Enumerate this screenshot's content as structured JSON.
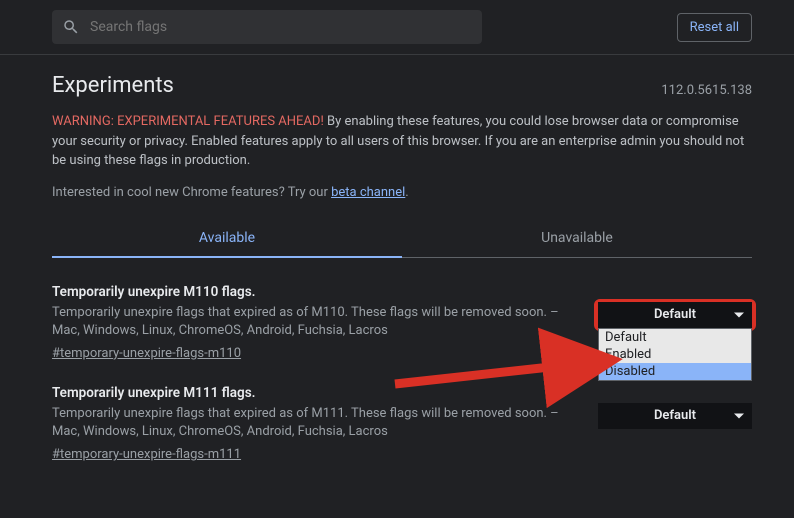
{
  "search": {
    "placeholder": "Search flags"
  },
  "reset_label": "Reset all",
  "title": "Experiments",
  "version": "112.0.5615.138",
  "warning_prefix": "WARNING: EXPERIMENTAL FEATURES AHEAD!",
  "warning_body": " By enabling these features, you could lose browser data or compromise your security or privacy. Enabled features apply to all users of this browser. If you are an enterprise admin you should not be using these flags in production.",
  "interest_text": "Interested in cool new Chrome features? Try our ",
  "beta_link": "beta channel",
  "tabs": {
    "available": "Available",
    "unavailable": "Unavailable"
  },
  "flags": [
    {
      "title": "Temporarily unexpire M110 flags.",
      "desc": "Temporarily unexpire flags that expired as of M110. These flags will be removed soon. – Mac, Windows, Linux, ChromeOS, Android, Fuchsia, Lacros",
      "anchor": "#temporary-unexpire-flags-m110",
      "value": "Default"
    },
    {
      "title": "Temporarily unexpire M111 flags.",
      "desc": "Temporarily unexpire flags that expired as of M111. These flags will be removed soon. – Mac, Windows, Linux, ChromeOS, Android, Fuchsia, Lacros",
      "anchor": "#temporary-unexpire-flags-m111",
      "value": "Default"
    }
  ],
  "dropdown_options": {
    "o0": "Default",
    "o1": "Enabled",
    "o2": "Disabled"
  },
  "annotation": {
    "highlight_color": "#d93025",
    "arrow_color": "#d93025"
  }
}
